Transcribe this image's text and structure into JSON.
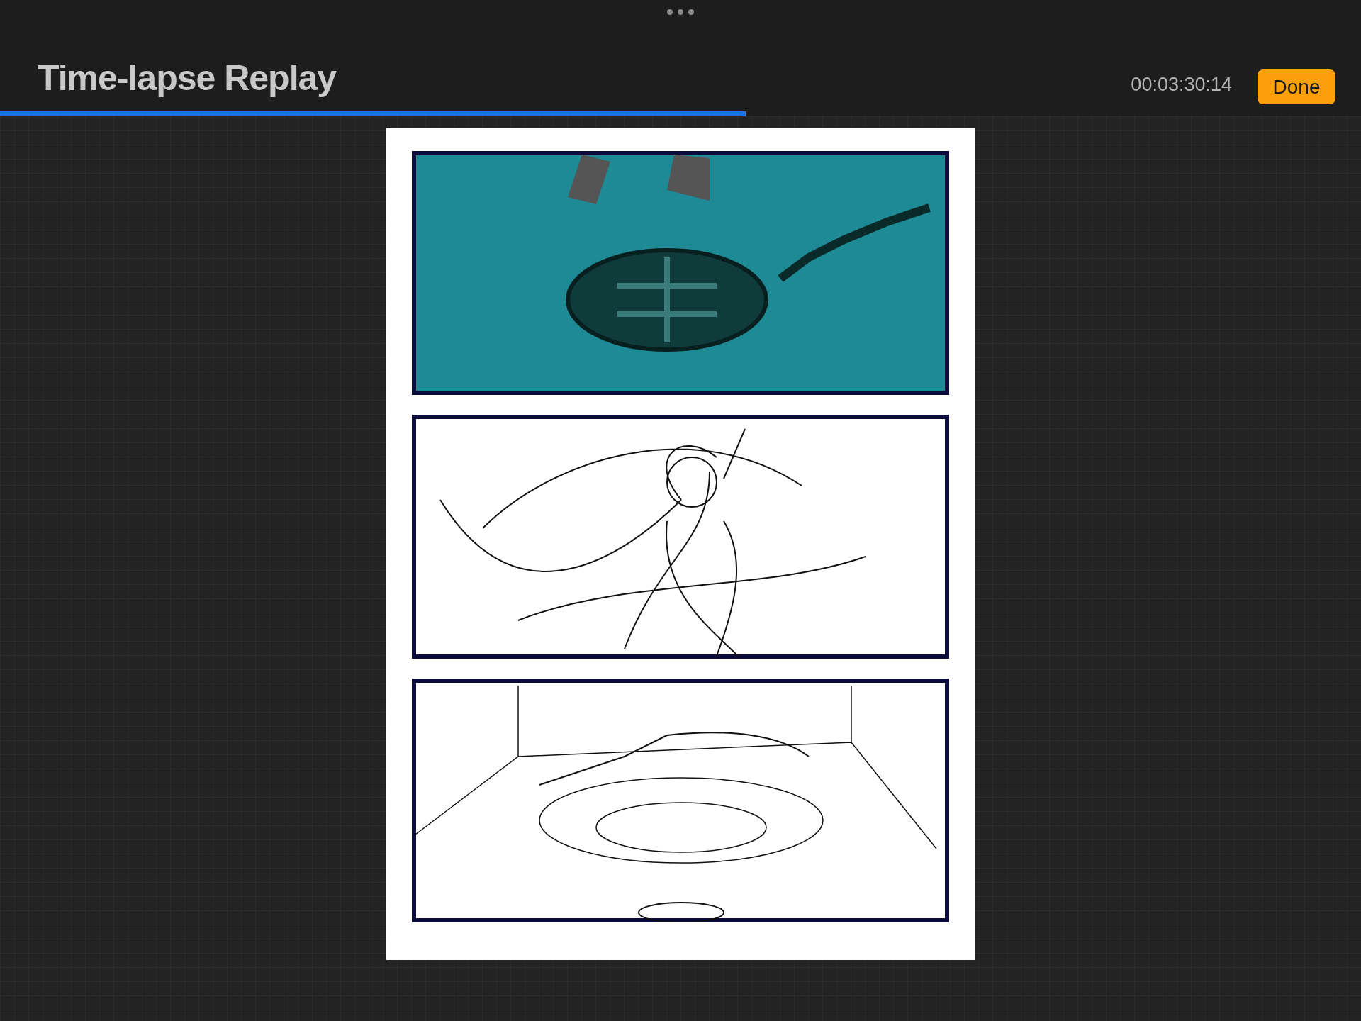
{
  "header": {
    "title": "Time-lapse Replay",
    "timestamp": "00:03:30:14",
    "done_button": "Done"
  },
  "progress": {
    "level": 0.548
  }
}
